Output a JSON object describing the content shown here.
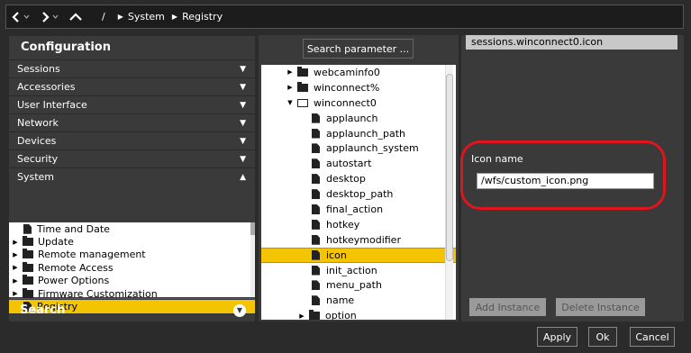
{
  "nav": {
    "breadcrumb_sep": "/",
    "breadcrumbs": [
      "System",
      "Registry"
    ]
  },
  "config": {
    "title": "Configuration",
    "sections": [
      {
        "label": "Sessions",
        "arrow": "▼"
      },
      {
        "label": "Accessories",
        "arrow": "▼"
      },
      {
        "label": "User Interface",
        "arrow": "▼"
      },
      {
        "label": "Network",
        "arrow": "▼"
      },
      {
        "label": "Devices",
        "arrow": "▼"
      },
      {
        "label": "Security",
        "arrow": "▼"
      },
      {
        "label": "System",
        "arrow": "▲"
      }
    ],
    "system_items": [
      {
        "label": "Time and Date",
        "type": "doc",
        "expandable": false
      },
      {
        "label": "Update",
        "type": "folder",
        "expandable": true
      },
      {
        "label": "Remote management",
        "type": "folder",
        "expandable": true
      },
      {
        "label": "Remote Access",
        "type": "folder",
        "expandable": true
      },
      {
        "label": "Power Options",
        "type": "folder",
        "expandable": true
      },
      {
        "label": "Firmware Customization",
        "type": "folder",
        "expandable": true
      },
      {
        "label": "Registry",
        "type": "doc",
        "expandable": false,
        "selected": true
      }
    ],
    "search_label": "Search"
  },
  "params": {
    "search_button": "Search parameter ...",
    "tree": [
      {
        "label": "webcaminfo0",
        "type": "folder",
        "expander": "▶",
        "indent": 0
      },
      {
        "label": "winconnect%",
        "type": "folder",
        "expander": "▶",
        "indent": 0
      },
      {
        "label": "winconnect0",
        "type": "folder-open",
        "expander": "▼",
        "indent": 0
      },
      {
        "label": "applaunch",
        "type": "doc",
        "expander": "",
        "indent": 1
      },
      {
        "label": "applaunch_path",
        "type": "doc",
        "expander": "",
        "indent": 1
      },
      {
        "label": "applaunch_system",
        "type": "doc",
        "expander": "",
        "indent": 1
      },
      {
        "label": "autostart",
        "type": "doc",
        "expander": "",
        "indent": 1
      },
      {
        "label": "desktop",
        "type": "doc",
        "expander": "",
        "indent": 1
      },
      {
        "label": "desktop_path",
        "type": "doc",
        "expander": "",
        "indent": 1
      },
      {
        "label": "final_action",
        "type": "doc",
        "expander": "",
        "indent": 1
      },
      {
        "label": "hotkey",
        "type": "doc",
        "expander": "",
        "indent": 1
      },
      {
        "label": "hotkeymodifier",
        "type": "doc",
        "expander": "",
        "indent": 1
      },
      {
        "label": "icon",
        "type": "doc",
        "expander": "",
        "indent": 1,
        "selected": true
      },
      {
        "label": "init_action",
        "type": "doc",
        "expander": "",
        "indent": 1
      },
      {
        "label": "menu_path",
        "type": "doc",
        "expander": "",
        "indent": 1
      },
      {
        "label": "name",
        "type": "doc",
        "expander": "",
        "indent": 1
      },
      {
        "label": "option",
        "type": "folder",
        "expander": "▶",
        "indent": 1
      }
    ]
  },
  "detail": {
    "path": "sessions.winconnect0.icon",
    "field_label": "Icon name",
    "field_value": "/wfs/custom_icon.png",
    "add_instance": "Add Instance",
    "delete_instance": "Delete Instance"
  },
  "footer": {
    "apply": "Apply",
    "ok": "Ok",
    "cancel": "Cancel"
  },
  "colors": {
    "selection": "#f5c400",
    "highlight_ring": "#e0141c",
    "panel": "#3a3a3a"
  }
}
